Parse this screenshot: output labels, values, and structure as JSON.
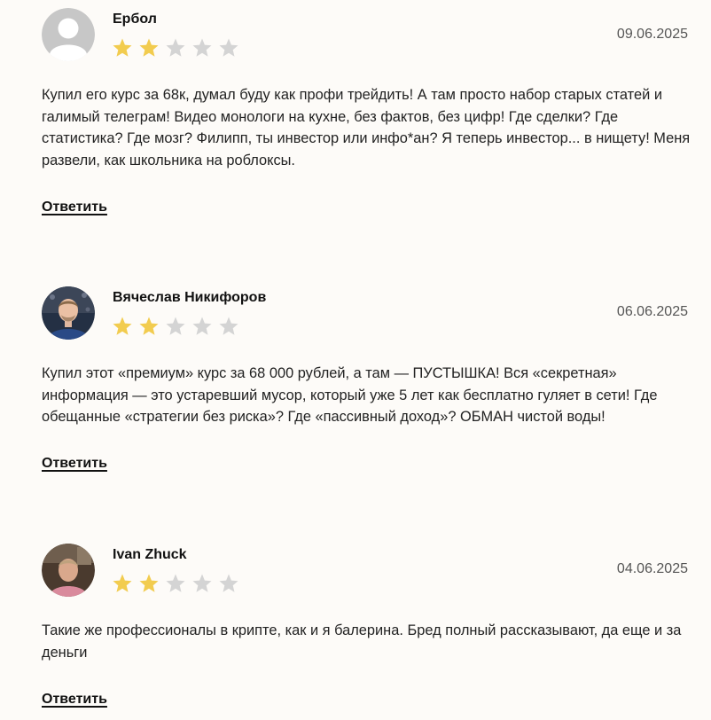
{
  "reviews": [
    {
      "author": "Ербол",
      "date": "09.06.2025",
      "rating": 2,
      "max_rating": 5,
      "avatar": "default-avatar-icon",
      "text": "Купил его курс за 68к, думал буду как профи трейдить! А там просто набор старых статей и галимый телеграм! Видео монологи на кухне, без фактов, без цифр! Где сделки? Где статистика? Где мозг? Филипп, ты инвестор или инфо*ан? Я теперь инвестор... в нищету! Меня развели, как школьника на роблоксы.",
      "reply_label": "Ответить"
    },
    {
      "author": "Вячеслав Никифоров",
      "date": "06.06.2025",
      "rating": 2,
      "max_rating": 5,
      "avatar": "user-photo",
      "text": "Купил этот «премиум» курс за 68 000 рублей, а там — ПУСТЫШКА! Вся «секретная» информация — это устаревший мусор, который уже 5 лет как бесплатно гуляет в сети! Где обещанные «стратегии без риска»? Где «пассивный доход»? ОБМАН чистой воды!",
      "reply_label": "Ответить"
    },
    {
      "author": "Ivan Zhuck",
      "date": "04.06.2025",
      "rating": 2,
      "max_rating": 5,
      "avatar": "user-photo",
      "text": "Такие же профессионалы в крипте, как и я балерина. Бред полный рассказывают, да еще и за деньги",
      "reply_label": "Ответить"
    }
  ],
  "colors": {
    "star_filled": "#f2cc4f",
    "star_empty": "#d4d4d4",
    "background": "#fdfbf8"
  }
}
